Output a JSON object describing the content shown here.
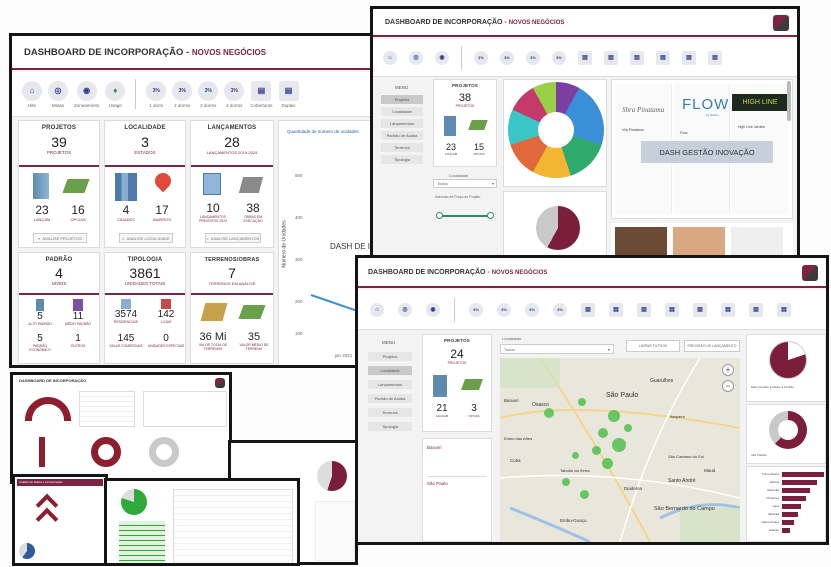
{
  "main_dash": {
    "title": "DASHBOARD DE INCORPORAÇÃO",
    "subtitle": "NOVOS NEGÓCIOS",
    "overlay_label": "DASH DE INCORPORAÇÃO",
    "toolbar": [
      "Hite",
      "Metas",
      "Zoneamento",
      "Usage",
      "1 dorm",
      "2 dorms",
      "3 dorms",
      "4 dorms",
      "Coberturas",
      "Duplex"
    ],
    "toolbar_icon_text": "3%",
    "kpis": {
      "projetos": {
        "title": "PROJETOS",
        "value": "39",
        "sub": "PROJETOS",
        "stats": [
          {
            "num": "23",
            "lbl": "LANÇAM"
          },
          {
            "num": "16",
            "lbl": "OPCIAS"
          }
        ],
        "search": "ANALISE PROJETOS"
      },
      "localidade": {
        "title": "LOCALIDADE",
        "value": "3",
        "sub": "ESTADOS",
        "stats": [
          {
            "num": "4",
            "lbl": "CIDADES"
          },
          {
            "num": "17",
            "lbl": "BAIRROS"
          }
        ],
        "search": "ANALISE LOCALIDADE"
      },
      "lancamentos": {
        "title": "LANÇAMENTOS",
        "value": "28",
        "sub": "LANÇAMENTOS 2019-2024",
        "stats": [
          {
            "num": "10",
            "lbl": "LANÇAMENTOS PREVISTOS 2024"
          },
          {
            "num": "38",
            "lbl": "OBRAS EM EXECUÇÃO"
          }
        ],
        "search": "ANALISE LANÇAMENTOS"
      },
      "padrao": {
        "title": "PADRÃO",
        "value": "4",
        "sub": "NÍVEIS",
        "stats": [
          {
            "num": "5",
            "lbl": "ALTO PADRÃO"
          },
          {
            "num": "11",
            "lbl": "MÉDIO PADRÃO"
          },
          {
            "num": "5",
            "lbl": "PADRÃO ECONÔMICO"
          },
          {
            "num": "1",
            "lbl": "OUTROS"
          }
        ]
      },
      "tipologia": {
        "title": "TIPOLOGIA",
        "value": "3861",
        "sub": "UNIDADES TOTAIS",
        "stats": [
          {
            "num": "3574",
            "lbl": "RESIDENCIAIS"
          },
          {
            "num": "142",
            "lbl": "LOJAS"
          },
          {
            "num": "145",
            "lbl": "SALAS COMERCIAIS"
          },
          {
            "num": "0",
            "lbl": "UNIDADES ESPECIAIS"
          }
        ]
      },
      "terrenos": {
        "title": "TERRENOS/OBRAS",
        "value": "7",
        "sub": "TERRENOS EM ANÁLISE",
        "stats": [
          {
            "num": "36 Mi",
            "lbl": "VALOR TOTAL DE TERRENOS"
          },
          {
            "num": "35",
            "lbl": "VALOR MÉDIO DE TERRENO"
          }
        ]
      }
    },
    "chart_axis_label": "Número de Unidades",
    "chart_ticks": [
      "500",
      "400",
      "300",
      "200",
      "100"
    ],
    "chart_x_tick": "jan 2021",
    "chart_caption": "Quantidade de número de unidades"
  },
  "innov_dash": {
    "title": "DASHBOARD DE INCORPORAÇÃO",
    "subtitle": "NOVOS NEGÓCIOS",
    "overlay_label": "DASH GESTÃO INOVAÇÃO",
    "nav": [
      "Projetos",
      "Localidade",
      "Lançamentos",
      "Padrão de Acaba",
      "Terrenos",
      "Tipologia"
    ],
    "nav_title": "MENU",
    "kpi": {
      "title": "PROJETOS",
      "value": "38",
      "sub": "PROJETOS",
      "stats": [
        {
          "num": "23",
          "lbl": "LANÇAM"
        },
        {
          "num": "15",
          "lbl": "OPCIAS"
        }
      ]
    },
    "filter_label": "Localidade",
    "filter_value": "Todos",
    "slider_label": "Intervalo de Preço do Projeto",
    "brands": [
      "Sbra Pinatama",
      "FLOW",
      "HIGH LINE"
    ],
    "brand_sub": "by Sertus",
    "card_lines": [
      "Vila Pinatama",
      "Flow",
      "High Line Jardins"
    ]
  },
  "map_dash": {
    "title": "DASHBOARD DE INCORPORAÇÃO",
    "subtitle": "NOVOS NEGÓCIOS",
    "nav": [
      "Projetos",
      "Localidade",
      "Lançamentos",
      "Padrão de Acaba",
      "Terrenos",
      "Tipologia"
    ],
    "nav_title": "MENU",
    "kpi": {
      "title": "PROJETOS",
      "value": "24",
      "sub": "PROJETOS",
      "stats": [
        {
          "num": "21",
          "lbl": "LANÇAM"
        },
        {
          "num": "3",
          "lbl": "OPCIAS"
        }
      ]
    },
    "filter_label": "Localidade",
    "filter_value": "Todos",
    "btn_a": "LIMPAR FILTROS",
    "btn_b": "PREVISÃO DE LANÇAMENTO",
    "places": [
      "Osasco",
      "São Paulo",
      "Guarulhos",
      "Barueri",
      "Santo André",
      "São Bernardo do Campo",
      "Mauá",
      "Cotia",
      "Embu das Artes",
      "Itaquera",
      "Diadema",
      "Taboão da Serra",
      "São Caetano do Sul",
      "Embu-Guaçu"
    ],
    "list_title_a": "Barueri",
    "list_title_b": "São Paulo",
    "chart_labels": [
      "Mais Vendido",
      "Médio",
      "Padrão",
      "Alto Padrão"
    ],
    "bar_labels": [
      "Trevo Aberto",
      "Jardins",
      "Morumbi",
      "Pinheiros",
      "Lapa",
      "Butantã",
      "Santo Amaro",
      "Osasco"
    ],
    "bar_values": [
      48,
      40,
      32,
      27,
      22,
      18,
      14,
      9
    ]
  },
  "mini_dash": {
    "title": "DASHBOARD DE INCORPORAÇÃO",
    "small_title": "Análise de Dados | Incorporação"
  }
}
